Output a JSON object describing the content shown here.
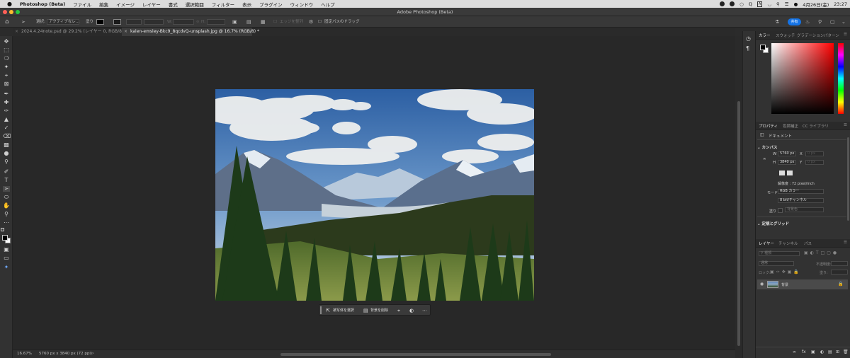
{
  "menubar": {
    "app_name": "Photoshop (Beta)",
    "items": [
      "ファイル",
      "編集",
      "イメージ",
      "レイヤー",
      "書式",
      "選択範囲",
      "フィルター",
      "表示",
      "プラグイン",
      "ウィンドウ",
      "ヘルプ"
    ],
    "date": "4月26日(金)",
    "time": "23:27"
  },
  "window": {
    "title": "Adobe Photoshop (Beta)"
  },
  "options": {
    "select_label": "選択:",
    "select_value": "アクティブなレ...",
    "fill_label": "塗り",
    "w_label": "W:",
    "h_label": "H:",
    "edge_label": "エッジを整列",
    "path_drag_label": "固定パスのドラッグ",
    "share_label": "共有"
  },
  "tabs": [
    {
      "label": "2024.4.24note.psd @ 29.2% (レイヤー 0, RGB/8)"
    },
    {
      "label": "kalen-emsley-Bkc9_8qcdvQ-unsplash.jpg @ 16.7% (RGB/8) *"
    }
  ],
  "contextbar": {
    "select_subject": "被写体を選択",
    "remove_bg": "背景を削除"
  },
  "status": {
    "zoom": "16.67%",
    "doc_info": "5760 px x 3840 px (72 ppi)"
  },
  "color_panel": {
    "tabs": [
      "カラー",
      "スウォッチ",
      "グラデーション",
      "パターン"
    ],
    "base_hue_color": "#ff0000"
  },
  "properties": {
    "tabs": [
      "プロパティ",
      "色調補正",
      "CC ライブラリ"
    ],
    "doc_type": "ドキュメント",
    "canvas_section": "カンバス",
    "w_label": "W",
    "w_value": "5760 px",
    "x_label": "X",
    "x_placeholder": "0 px",
    "h_label": "H",
    "h_value": "3840 px",
    "y_label": "Y",
    "y_placeholder": "0 px",
    "resolution": "解像度 : 72 pixel/inch",
    "mode_label": "モード",
    "mode_value": "RGB カラー",
    "depth_value": "8 bit/チャンネル",
    "fill_label": "塗り",
    "fill_value": "背景色",
    "rulers_section": "定規とグリッド"
  },
  "layers": {
    "tabs": [
      "レイヤー",
      "チャンネル",
      "パス"
    ],
    "search_placeholder": "種類",
    "blend_mode": "通常",
    "opacity_label": "不透明度:",
    "lock_label": "ロック:",
    "fill_label": "塗り:",
    "items": [
      {
        "name": "背景"
      }
    ]
  }
}
